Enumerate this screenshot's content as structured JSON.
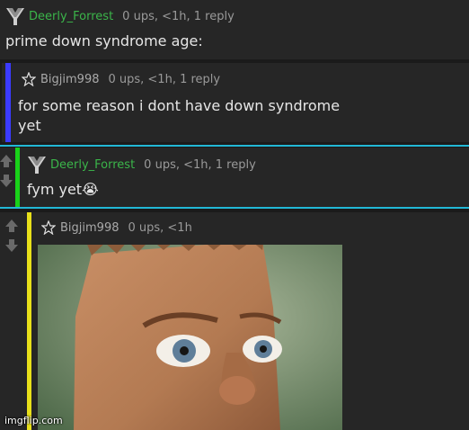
{
  "comments": [
    {
      "username": "Deerly_Forrest",
      "stats": "0 ups, <1h, 1 reply",
      "text": "prime down syndrome age:"
    },
    {
      "username": "Bigjim998",
      "stats": "0 ups, <1h, 1 reply",
      "text": "for some reason i dont have down syndrome yet"
    },
    {
      "username": "Deerly_Forrest",
      "stats": "0 ups, <1h, 1 reply",
      "text": "fym yet😭"
    },
    {
      "username": "Bigjim998",
      "stats": "0 ups, <1h"
    }
  ],
  "watermark": "imgflip.com",
  "colors": {
    "reply_bar_2": "#3b3bff",
    "reply_bar_3": "#19d219",
    "reply_bar_4": "#e8e01a",
    "username_green": "#3bb54a",
    "separator_cyan": "#22b8d6"
  },
  "icons": {
    "user_badge_forrest": "shield-logo-icon",
    "user_badge_bigjim": "star-outline-icon",
    "vote_up": "arrow-up-icon",
    "vote_down": "arrow-down-icon"
  }
}
